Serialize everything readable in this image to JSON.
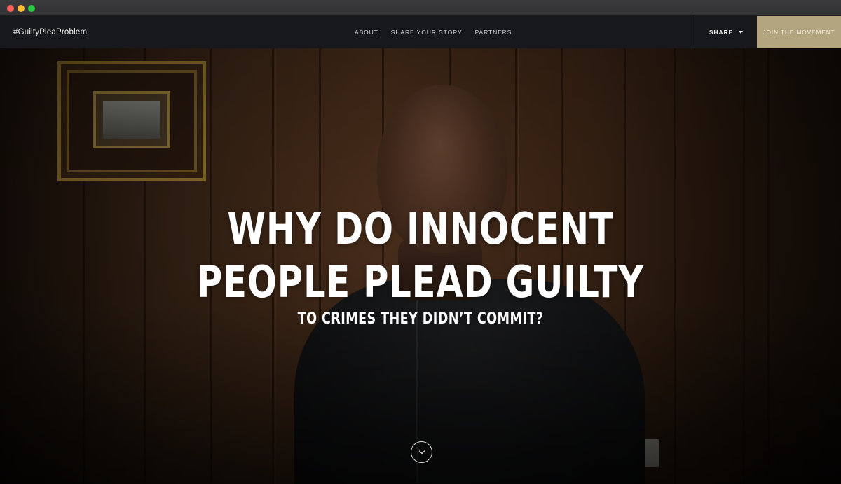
{
  "window": {
    "controls": [
      "close",
      "minimize",
      "maximize"
    ],
    "colors": {
      "close": "#fe5f57",
      "minimize": "#febc2e",
      "maximize": "#28c840"
    }
  },
  "nav": {
    "brand": "#GuiltyPleaProblem",
    "links": [
      {
        "label": "ABOUT"
      },
      {
        "label": "SHARE YOUR STORY"
      },
      {
        "label": "PARTNERS"
      }
    ],
    "share": {
      "label": "SHARE",
      "icon": "caret-down-icon"
    },
    "cta": {
      "label": "JOIN THE MOVEMENT",
      "color": "#b3a57f"
    }
  },
  "hero": {
    "headline_line1": "WHY DO INNOCENT",
    "headline_line2": "PEOPLE PLEAD GUILTY",
    "subheadline": "TO CRIMES THEY DIDN’T COMMIT?",
    "scroll_icon": "chevron-down-icon"
  }
}
